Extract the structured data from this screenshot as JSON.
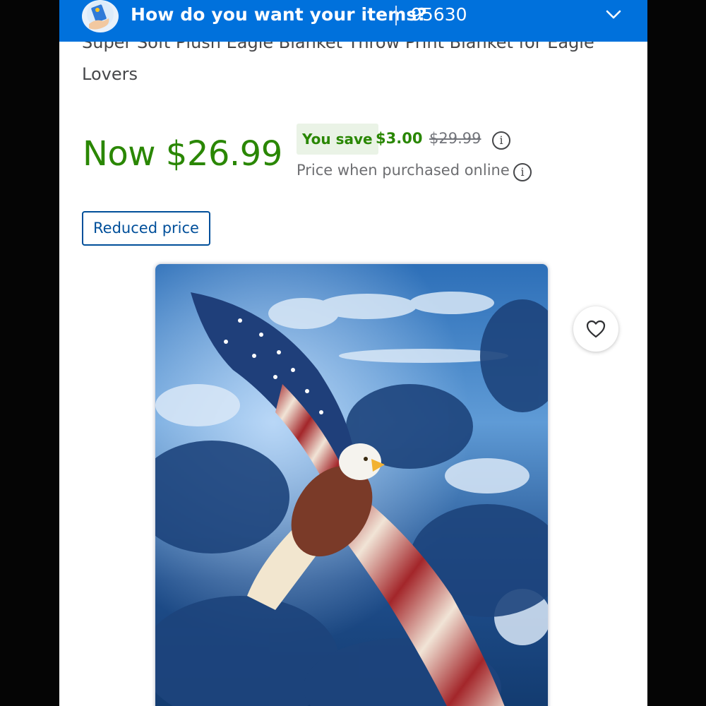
{
  "delivery_bar": {
    "title": "How do you want your items?",
    "zip": "95630",
    "avatar_icon": "delivery-avatar-icon",
    "chevron_icon": "chevron-down-icon",
    "background": "#0071dc"
  },
  "product": {
    "title_partial": "Super Soft Plush Eagle Blanket Throw Print Blanket for Eagle",
    "title_line2": "Lovers"
  },
  "pricing": {
    "now_price": "Now $26.99",
    "you_save_label": "You save",
    "save_amount": "$3.00",
    "was_price": "$29.99",
    "online_note": "Price when purchased online",
    "info_icon": "info-icon",
    "price_color": "#2a8703"
  },
  "badge": {
    "label": "Reduced price"
  },
  "image": {
    "favorite_icon": "heart-icon"
  }
}
